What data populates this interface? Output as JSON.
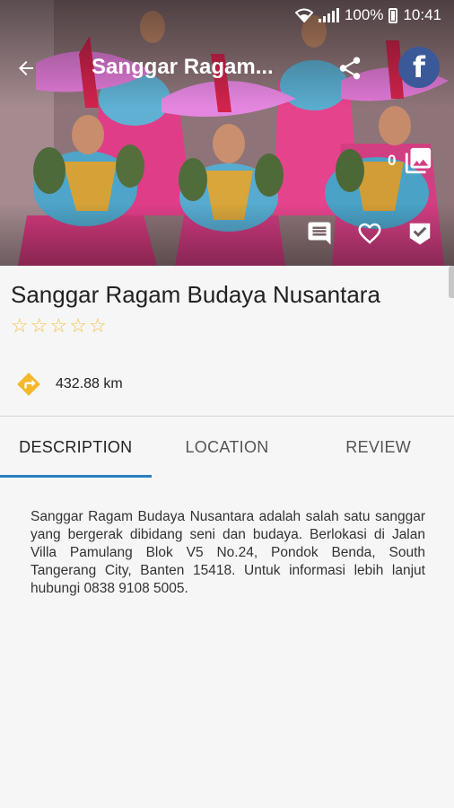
{
  "status_bar": {
    "battery": "100%",
    "time": "10:41"
  },
  "header": {
    "title": "Sanggar Ragam...",
    "back_icon": "arrow-left-icon",
    "share_icon": "share-icon",
    "facebook_icon": "facebook-icon"
  },
  "hero": {
    "gallery_count": "0",
    "actions": [
      "comment-icon",
      "heart-icon",
      "check-icon"
    ]
  },
  "place": {
    "name": "Sanggar Ragam Budaya Nusantara",
    "rating": 0,
    "rating_max": 5,
    "distance": "432.88 km"
  },
  "tabs": [
    {
      "label": "DESCRIPTION",
      "active": true
    },
    {
      "label": "LOCATION",
      "active": false
    },
    {
      "label": "REVIEW",
      "active": false
    }
  ],
  "description": "Sanggar Ragam Budaya Nusantara adalah salah satu sanggar yang bergerak dibidang seni dan budaya. Berlokasi di Jalan Villa Pamulang Blok V5 No.24, Pondok Benda, South Tangerang City, Banten 15418. Untuk informasi lebih lanjut hubungi 0838 9108 5005.",
  "colors": {
    "accent": "#2a7fc2",
    "star": "#f3c24d",
    "direction_sign": "#f4b82a",
    "facebook": "#3b5998"
  }
}
